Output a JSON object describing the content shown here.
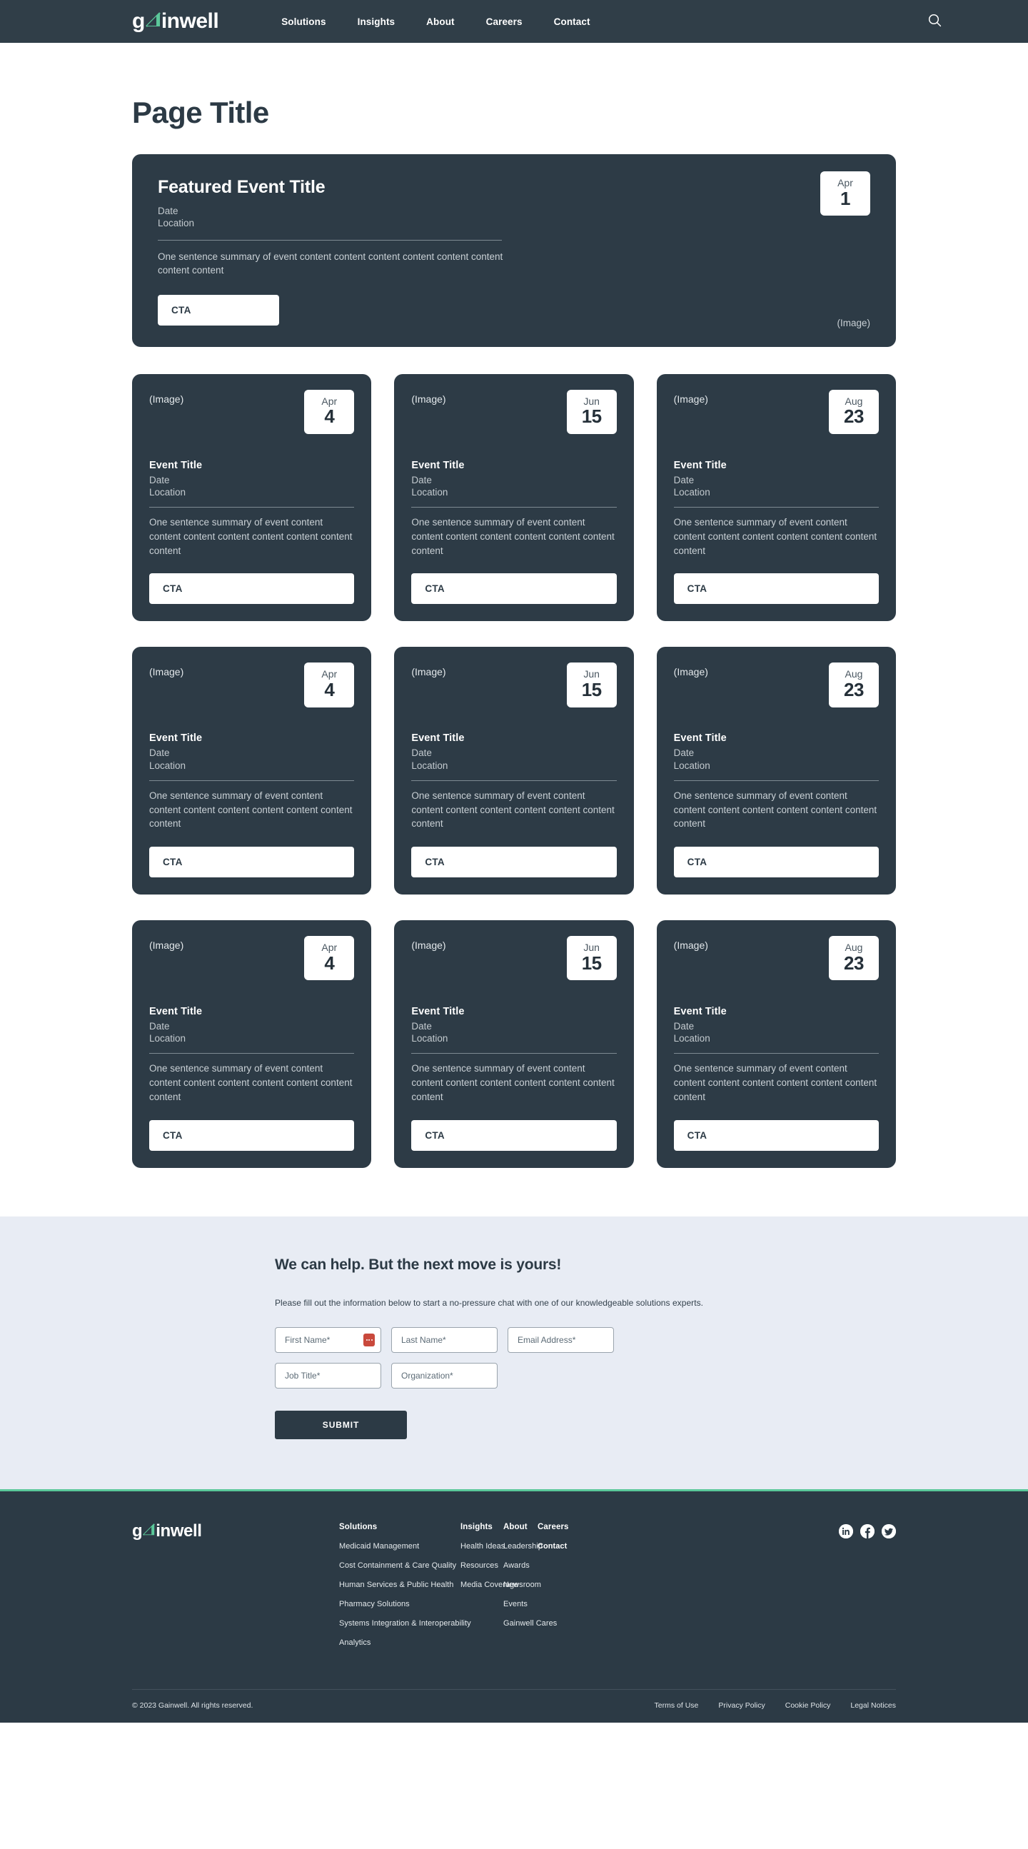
{
  "brand": {
    "name": "gainwell",
    "name_prefix": "g",
    "name_suffix": "inwell",
    "accent_color": "#5BC89A",
    "dark_color": "#2C3A45",
    "panel_color": "#2D3B46",
    "band_color": "#E8ECF4"
  },
  "header": {
    "logo_label": "gainwell-logo",
    "nav": [
      {
        "label": "Solutions"
      },
      {
        "label": "Insights"
      },
      {
        "label": "About"
      },
      {
        "label": "Careers"
      },
      {
        "label": "Contact"
      }
    ],
    "search_icon": "search-icon"
  },
  "page": {
    "title": "Page Title"
  },
  "featured_event": {
    "title": "Featured Event Title",
    "date_label": "Date",
    "location_label": "Location",
    "summary": "One sentence summary of event content content content content  content content content content",
    "cta_label": "CTA",
    "image_placeholder": "(Image)",
    "badge": {
      "month": "Apr",
      "day": "1"
    }
  },
  "events": [
    {
      "image_placeholder": "(Image)",
      "badge": {
        "month": "Apr",
        "day": "4"
      },
      "title": "Event Title",
      "date_label": "Date",
      "location_label": "Location",
      "summary": "One sentence summary of event content content content content content content content content",
      "cta_label": "CTA"
    },
    {
      "image_placeholder": "(Image)",
      "badge": {
        "month": "Jun",
        "day": "15"
      },
      "title": "Event Title",
      "date_label": "Date",
      "location_label": "Location",
      "summary": "One sentence summary of event content content content content content content content content",
      "cta_label": "CTA"
    },
    {
      "image_placeholder": "(Image)",
      "badge": {
        "month": "Aug",
        "day": "23"
      },
      "title": "Event Title",
      "date_label": "Date",
      "location_label": "Location",
      "summary": "One sentence summary of event content content content content content content content content",
      "cta_label": "CTA"
    },
    {
      "image_placeholder": "(Image)",
      "badge": {
        "month": "Apr",
        "day": "4"
      },
      "title": "Event Title",
      "date_label": "Date",
      "location_label": "Location",
      "summary": "One sentence summary of event content content content content content content content content",
      "cta_label": "CTA"
    },
    {
      "image_placeholder": "(Image)",
      "badge": {
        "month": "Jun",
        "day": "15"
      },
      "title": "Event Title",
      "date_label": "Date",
      "location_label": "Location",
      "summary": "One sentence summary of event content content content content content content content content",
      "cta_label": "CTA"
    },
    {
      "image_placeholder": "(Image)",
      "badge": {
        "month": "Aug",
        "day": "23"
      },
      "title": "Event Title",
      "date_label": "Date",
      "location_label": "Location",
      "summary": "One sentence summary of event content content content content content content content content",
      "cta_label": "CTA"
    },
    {
      "image_placeholder": "(Image)",
      "badge": {
        "month": "Apr",
        "day": "4"
      },
      "title": "Event Title",
      "date_label": "Date",
      "location_label": "Location",
      "summary": "One sentence summary of event content content content content content content content content",
      "cta_label": "CTA"
    },
    {
      "image_placeholder": "(Image)",
      "badge": {
        "month": "Jun",
        "day": "15"
      },
      "title": "Event Title",
      "date_label": "Date",
      "location_label": "Location",
      "summary": "One sentence summary of event content content content content content content content content",
      "cta_label": "CTA"
    },
    {
      "image_placeholder": "(Image)",
      "badge": {
        "month": "Aug",
        "day": "23"
      },
      "title": "Event Title",
      "date_label": "Date",
      "location_label": "Location",
      "summary": "One sentence summary of event content content content content content content content content",
      "cta_label": "CTA"
    }
  ],
  "contact_form": {
    "heading": "We can help. But the next move is yours!",
    "subtext": "Please fill out the information below to start a no-pressure chat with one of our knowledgeable solutions experts.",
    "fields": {
      "first_name": {
        "placeholder": "First Name*",
        "value": ""
      },
      "last_name": {
        "placeholder": "Last Name*",
        "value": ""
      },
      "email": {
        "placeholder": "Email Address*",
        "value": ""
      },
      "job_title": {
        "placeholder": "Job Title*",
        "value": ""
      },
      "organization": {
        "placeholder": "Organization*",
        "value": ""
      }
    },
    "autofill_icon": "autofill-icon",
    "submit_label": "SUBMIT"
  },
  "footer": {
    "logo_label": "gainwell-logo",
    "columns": [
      {
        "heading": "Solutions",
        "links": [
          {
            "label": "Medicaid Management",
            "bold": false
          },
          {
            "label": "Cost Containment & Care Quality",
            "bold": false
          },
          {
            "label": "Human Services & Public Health",
            "bold": false
          },
          {
            "label": "Pharmacy Solutions",
            "bold": false
          },
          {
            "label": "Systems Integration & Interoperability",
            "bold": false
          },
          {
            "label": "Analytics",
            "bold": false
          }
        ]
      },
      {
        "heading": "Insights",
        "links": [
          {
            "label": "Health Ideas",
            "bold": false
          },
          {
            "label": "Resources",
            "bold": false
          },
          {
            "label": "Media Coverage",
            "bold": false
          }
        ]
      },
      {
        "heading": "About",
        "links": [
          {
            "label": "Leadership",
            "bold": false
          },
          {
            "label": "Awards",
            "bold": false
          },
          {
            "label": "Newsroom",
            "bold": false
          },
          {
            "label": "Events",
            "bold": false
          },
          {
            "label": "Gainwell Cares",
            "bold": false
          }
        ]
      },
      {
        "heading": "Careers",
        "links": [
          {
            "label": "Contact",
            "bold": true
          }
        ]
      }
    ],
    "socials": [
      {
        "name": "linkedin-icon"
      },
      {
        "name": "facebook-icon"
      },
      {
        "name": "twitter-icon"
      }
    ],
    "copyright": "© 2023 Gainwell. All rights reserved.",
    "legal_links": [
      {
        "label": "Terms of Use"
      },
      {
        "label": "Privacy Policy"
      },
      {
        "label": "Cookie Policy"
      },
      {
        "label": "Legal Notices"
      }
    ]
  }
}
